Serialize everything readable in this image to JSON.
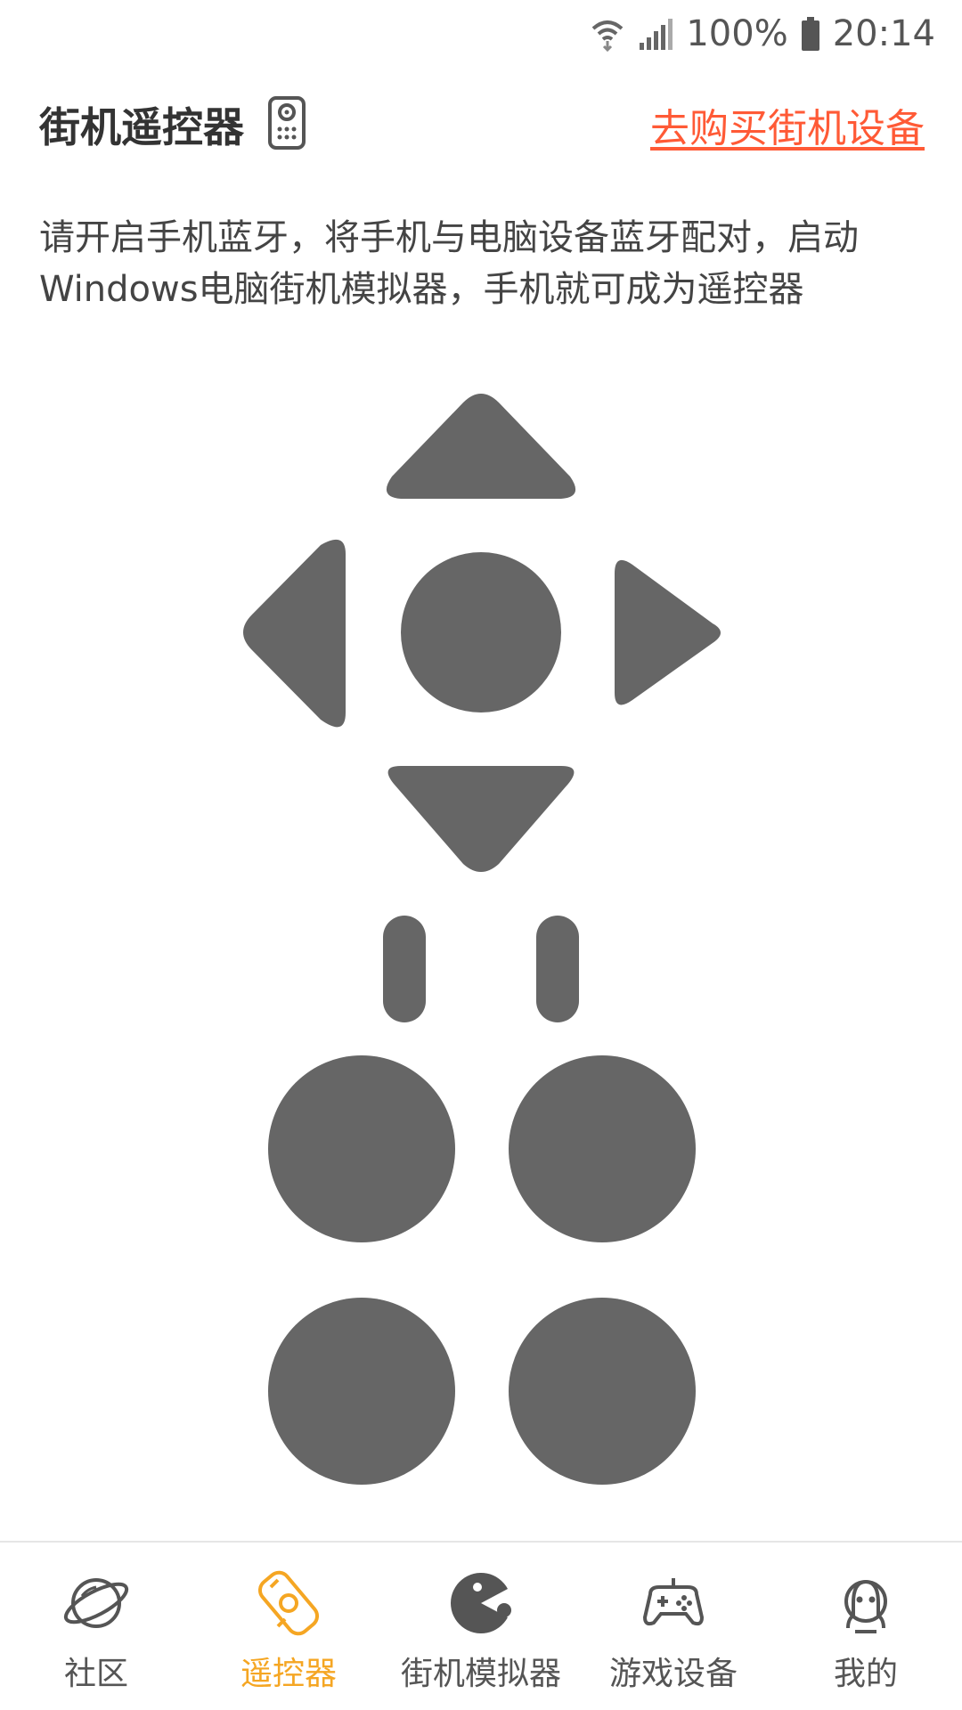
{
  "status_bar": {
    "wifi_icon": "wifi-icon",
    "signal_icon": "signal-icon",
    "battery_percent": "100%",
    "battery_icon": "battery-icon",
    "time": "20:14"
  },
  "header": {
    "title": "街机遥控器",
    "title_icon": "remote-icon",
    "buy_link": "去购买街机设备"
  },
  "instructions": "请开启手机蓝牙，将手机与电脑设备蓝牙配对，启动Windows电脑街机模拟器，手机就可成为遥控器",
  "controller": {
    "button_color": "#666666",
    "buttons": [
      "dpad-up",
      "dpad-left",
      "dpad-center",
      "dpad-right",
      "dpad-down",
      "select",
      "start",
      "action-1",
      "action-2",
      "action-3",
      "action-4"
    ]
  },
  "bottom_nav": {
    "accent_color": "#f5a623",
    "items": [
      {
        "label": "社区",
        "icon": "planet-icon",
        "active": false
      },
      {
        "label": "遥控器",
        "icon": "remote-control-icon",
        "active": true
      },
      {
        "label": "街机模拟器",
        "icon": "pacman-icon",
        "active": false
      },
      {
        "label": "游戏设备",
        "icon": "gamepad-icon",
        "active": false
      },
      {
        "label": "我的",
        "icon": "profile-icon",
        "active": false
      }
    ]
  }
}
